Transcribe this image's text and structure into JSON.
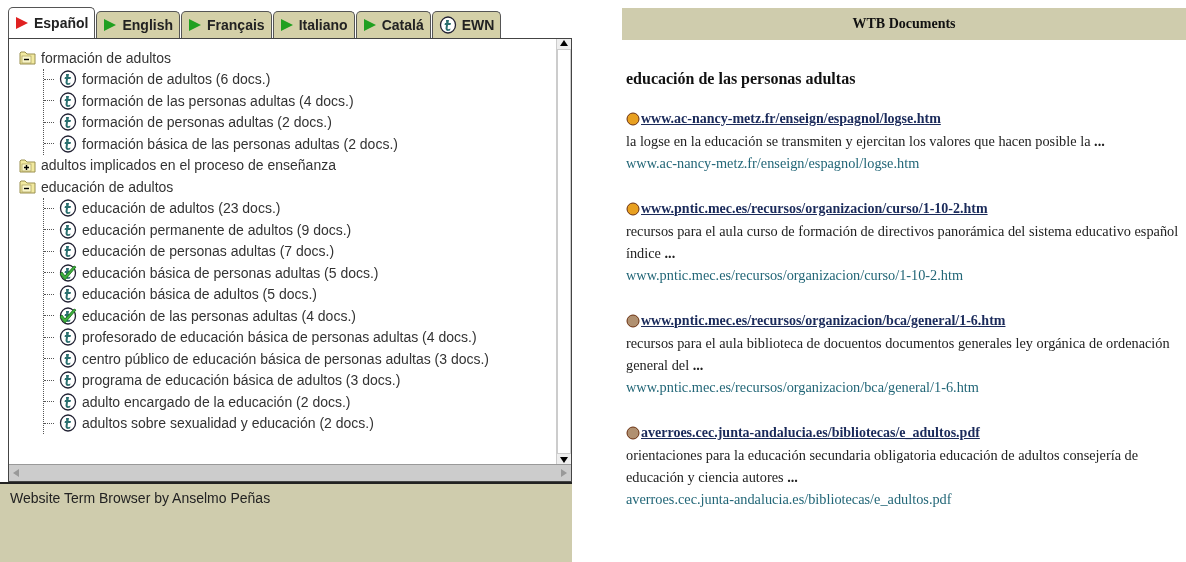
{
  "tabs": [
    {
      "label": "Español",
      "kind": "language",
      "selected": true
    },
    {
      "label": "English",
      "kind": "language",
      "selected": false
    },
    {
      "label": "Français",
      "kind": "language",
      "selected": false
    },
    {
      "label": "Italiano",
      "kind": "language",
      "selected": false
    },
    {
      "label": "Catalá",
      "kind": "language",
      "selected": false
    },
    {
      "label": "EWN",
      "kind": "wordnet",
      "selected": false
    }
  ],
  "tree": [
    {
      "kind": "folder",
      "label": "formación de adultos",
      "expanded": true,
      "children": [
        {
          "kind": "term",
          "label": "formación de adultos (6 docs.)",
          "checked": false
        },
        {
          "kind": "term",
          "label": "formación de las personas adultas (4 docs.)",
          "checked": false
        },
        {
          "kind": "term",
          "label": "formación de personas adultas (2 docs.)",
          "checked": false
        },
        {
          "kind": "term",
          "label": "formación básica de las personas adultas (2 docs.)",
          "checked": false
        }
      ]
    },
    {
      "kind": "folder",
      "label": "adultos implicados en el proceso de enseñanza",
      "expanded": false
    },
    {
      "kind": "folder",
      "label": "educación de adultos",
      "expanded": true,
      "children": [
        {
          "kind": "term",
          "label": "educación de adultos (23 docs.)",
          "checked": false
        },
        {
          "kind": "term",
          "label": "educación permanente de adultos (9 docs.)",
          "checked": false
        },
        {
          "kind": "term",
          "label": "educación de personas adultas (7 docs.)",
          "checked": false
        },
        {
          "kind": "term",
          "label": "educación básica de personas adultas (5 docs.)",
          "checked": true
        },
        {
          "kind": "term",
          "label": "educación básica de adultos (5 docs.)",
          "checked": false
        },
        {
          "kind": "term",
          "label": "educación de las personas adultas (4 docs.)",
          "checked": true
        },
        {
          "kind": "term",
          "label": "profesorado de educación básica de personas adultas (4 docs.)",
          "checked": false
        },
        {
          "kind": "term",
          "label": "centro público de educación básica de personas adultas (3 docs.)",
          "checked": false
        },
        {
          "kind": "term",
          "label": "programa de educación básica de adultos (3 docs.)",
          "checked": false
        },
        {
          "kind": "term",
          "label": "adulto encargado de la educación (2 docs.)",
          "checked": false
        },
        {
          "kind": "term",
          "label": "adultos sobre sexualidad y educación (2 docs.)",
          "checked": false
        }
      ]
    }
  ],
  "status_bar": "Website Term Browser by Anselmo Peñas",
  "documents": {
    "title": "WTB Documents",
    "query": "educación de las personas adultas",
    "results": [
      {
        "link": "www.ac-nancy-metz.fr/enseign/espagnol/logse.htm",
        "color": "#e8a020",
        "snippet": "la logse en la educación se transmiten y ejercitan los valores que hacen posible la **...**",
        "url": "www.ac-nancy-metz.fr/enseign/espagnol/logse.htm"
      },
      {
        "link": "www.pntic.mec.es/recursos/organizacion/curso/1-10-2.htm",
        "color": "#e8a020",
        "snippet": "recursos para el aula curso de formación de directivos panorámica del sistema educativo español índice **...**",
        "url": "www.pntic.mec.es/recursos/organizacion/curso/1-10-2.htm"
      },
      {
        "link": "www.pntic.mec.es/recursos/organizacion/bca/general/1-6.htm",
        "color": "#b09070",
        "snippet": "recursos para el aula biblioteca de docuentos documentos generales ley orgánica de ordenación general del **...**",
        "url": "www.pntic.mec.es/recursos/organizacion/bca/general/1-6.htm"
      },
      {
        "link": "averroes.cec.junta-andalucia.es/bibliotecas/e_adultos.pdf",
        "color": "#b09070",
        "snippet": "orientaciones para la educación secundaria obligatoria educación de adultos consejería de educación y ciencia autores **...**",
        "url": "averroes.cec.junta-andalucia.es/bibliotecas/e_adultos.pdf"
      }
    ]
  }
}
